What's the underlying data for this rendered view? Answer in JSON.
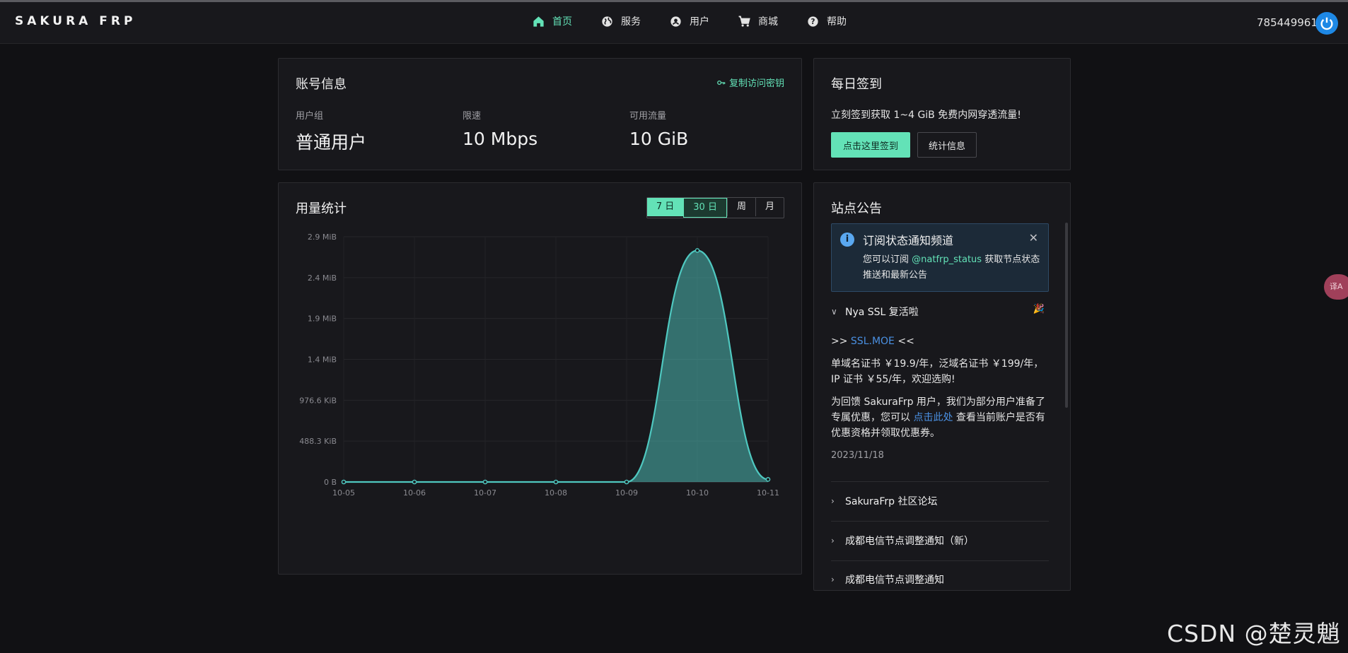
{
  "brand": "SAKURA FRP",
  "nav": [
    {
      "label": "首页",
      "icon": "home-icon",
      "active": true
    },
    {
      "label": "服务",
      "icon": "globe-icon",
      "active": false
    },
    {
      "label": "用户",
      "icon": "user-icon",
      "active": false
    },
    {
      "label": "商城",
      "icon": "cart-icon",
      "active": false
    },
    {
      "label": "帮助",
      "icon": "help-icon",
      "active": false
    }
  ],
  "user": {
    "id": "785449961",
    "icon": "power-icon"
  },
  "account": {
    "title": "账号信息",
    "copy_key": "复制访问密钥",
    "stats": [
      {
        "label": "用户组",
        "value": "普通用户"
      },
      {
        "label": "限速",
        "value": "10 Mbps"
      },
      {
        "label": "可用流量",
        "value": "10 GiB"
      }
    ]
  },
  "checkin": {
    "title": "每日签到",
    "desc": "立刻签到获取 1~4 GiB 免费内网穿透流量!",
    "checkin_button": "点击这里签到",
    "stats_button": "统计信息"
  },
  "usage": {
    "title": "用量统计",
    "periods": [
      "7 日",
      "30 日",
      "周",
      "月"
    ],
    "selected_period": "7 日"
  },
  "chart_data": {
    "type": "area",
    "x": [
      "10-05",
      "10-06",
      "10-07",
      "10-08",
      "10-09",
      "10-10",
      "10-11"
    ],
    "y_ticks": [
      "0 B",
      "488.3 KiB",
      "976.6 KiB",
      "1.4 MiB",
      "1.9 MiB",
      "2.4 MiB",
      "2.9 MiB"
    ],
    "ylim_mib": [
      0,
      2.86
    ],
    "series": [
      {
        "values_mib": [
          0,
          0,
          0,
          0,
          0,
          2.7,
          0.03
        ]
      }
    ],
    "color": "#4fc8c0",
    "grid": true
  },
  "notice": {
    "title": "站点公告",
    "subscribe": {
      "title": "订阅状态通知频道",
      "body_prefix": "您可以订阅 ",
      "tag": "@natfrp_status",
      "body_suffix": " 获取节点状态推送和最新公告",
      "close": "✕"
    },
    "expanded": {
      "title": "Nya SSL 复活啦",
      "line1_prefix": ">> ",
      "line1_link": "SSL.MOE",
      "line1_suffix": " <<",
      "line2": "单域名证书 ￥19.9/年，泛域名证书 ￥199/年，IP 证书 ￥55/年，欢迎选购!",
      "line3_prefix": "为回馈 SakuraFrp 用户，我们为部分用户准备了专属优惠，您可以 ",
      "line3_link": "点击此处",
      "line3_suffix": " 查看当前账户是否有优惠资格并领取优惠券。",
      "date": "2023/11/18"
    },
    "collapsed": [
      "SakuraFrp 社区论坛",
      "成都电信节点调整通知（新）",
      "成都电信节点调整通知"
    ]
  },
  "translate_tab": "译A",
  "watermark": "CSDN @楚灵魈"
}
